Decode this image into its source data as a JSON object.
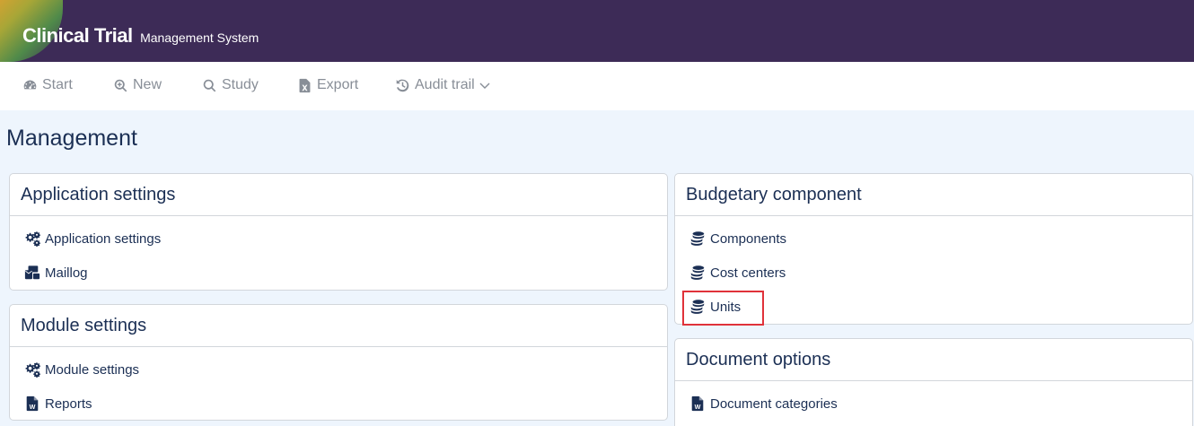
{
  "header": {
    "brand_main": "Clinical Trial",
    "brand_sub": "Management System"
  },
  "nav": {
    "start": {
      "label": "Start",
      "icon": "dashboard-icon"
    },
    "new": {
      "label": "New",
      "icon": "search-plus-icon"
    },
    "study": {
      "label": "Study",
      "icon": "search-icon"
    },
    "export": {
      "label": "Export",
      "icon": "excel-file-icon"
    },
    "audit": {
      "label": "Audit trail",
      "icon": "history-icon"
    }
  },
  "page": {
    "title": "Management"
  },
  "cards": {
    "application_settings": {
      "title": "Application settings",
      "items": [
        {
          "label": "Application settings",
          "icon": "cogs-icon"
        },
        {
          "label": "Maillog",
          "icon": "mail-bulk-icon"
        }
      ]
    },
    "module_settings": {
      "title": "Module settings",
      "items": [
        {
          "label": "Module settings",
          "icon": "cogs-icon"
        },
        {
          "label": "Reports",
          "icon": "word-file-icon"
        }
      ]
    },
    "budgetary_component": {
      "title": "Budgetary component",
      "items": [
        {
          "label": "Components",
          "icon": "coins-icon"
        },
        {
          "label": "Cost centers",
          "icon": "coins-icon"
        },
        {
          "label": "Units",
          "icon": "coins-icon"
        }
      ]
    },
    "document_options": {
      "title": "Document options",
      "items": [
        {
          "label": "Document categories",
          "icon": "word-file-icon"
        }
      ]
    }
  },
  "colors": {
    "header_bg": "#3d2b57",
    "content_bg": "#eef5fd",
    "text_dark": "#1b2f54",
    "highlight": "#e0323a"
  }
}
